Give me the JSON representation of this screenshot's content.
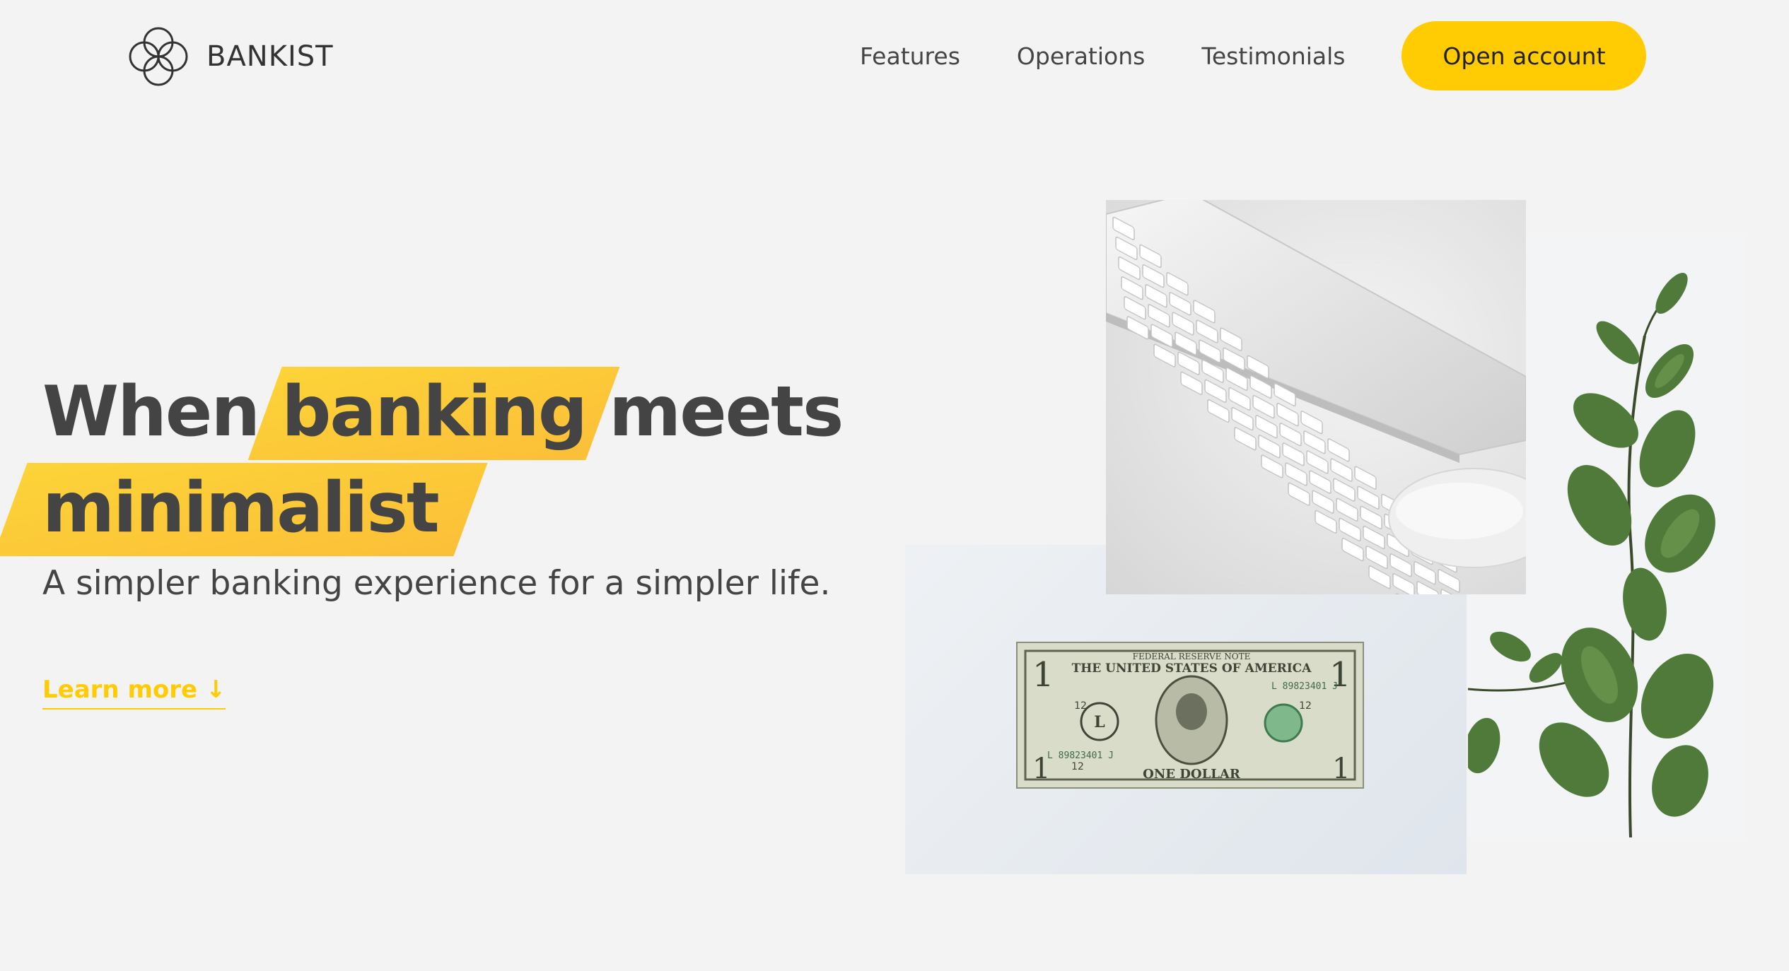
{
  "nav": {
    "logo_text": "BANKIST",
    "links": [
      {
        "label": "Features"
      },
      {
        "label": "Operations"
      },
      {
        "label": "Testimonials"
      }
    ],
    "cta_label": "Open account"
  },
  "hero": {
    "title_word_1": "When",
    "title_highlight_1": "banking",
    "title_word_2": "meets",
    "title_highlight_2": "minimalist",
    "subtitle": "A simpler banking experience for a simpler life.",
    "learn_more": "Learn more ↓"
  },
  "dollar_bill": {
    "top_banner": "FEDERAL RESERVE NOTE",
    "country": "THE UNITED STATES OF AMERICA",
    "serial": "L 89823401 J",
    "denomination_text": "ONE DOLLAR",
    "corner_numeral": "1",
    "small_numeral": "12",
    "seal_letter": "L"
  },
  "colors": {
    "accent": "#ffcb03",
    "accent_dark": "#ffb003",
    "background": "#f3f3f3",
    "text": "#444444"
  },
  "icons": {
    "logo": "interlocking-circles-icon"
  }
}
